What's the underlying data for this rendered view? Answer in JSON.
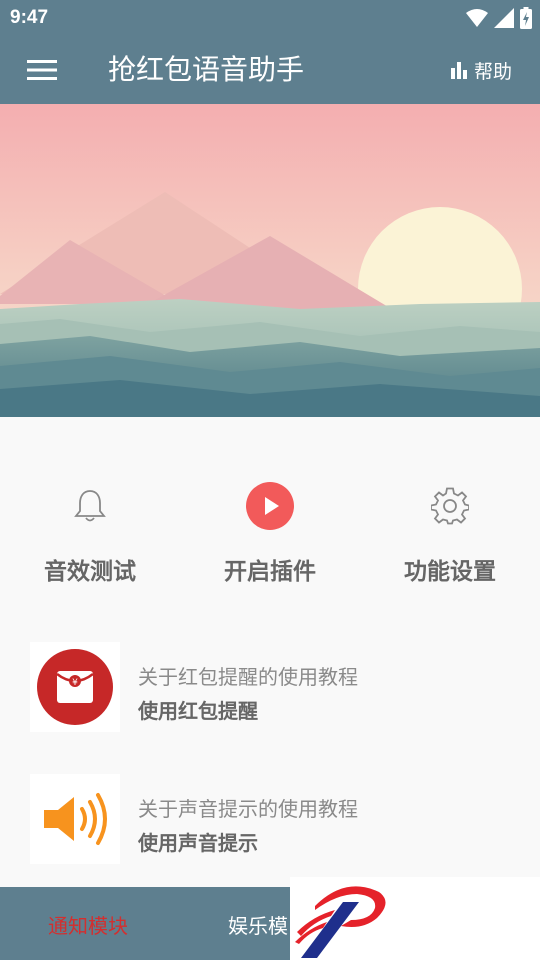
{
  "status_bar": {
    "time": "9:47",
    "icons": [
      "wifi-icon",
      "signal-icon",
      "battery-icon"
    ]
  },
  "app_bar": {
    "title": "抢红包语音助手",
    "help_label": "帮助",
    "menu_icon": "hamburger-menu-icon",
    "help_icon": "bar-chart-icon"
  },
  "actions": [
    {
      "label": "音效测试",
      "icon": "bell-icon"
    },
    {
      "label": "开启插件",
      "icon": "play-circle-icon"
    },
    {
      "label": "功能设置",
      "icon": "gear-icon"
    }
  ],
  "tutorials": [
    {
      "subtitle": "关于红包提醒的使用教程",
      "title": "使用红包提醒",
      "icon": "red-envelope-icon"
    },
    {
      "subtitle": "关于声音提示的使用教程",
      "title": "使用声音提示",
      "icon": "speaker-icon"
    }
  ],
  "bottom_nav": {
    "tabs": [
      {
        "label": "通知模块",
        "active": true
      },
      {
        "label": "娱乐模",
        "active": false
      }
    ]
  },
  "colors": {
    "primary": "#5e7f8f",
    "accent_red": "#d32f2f",
    "play_red": "#f25a5a",
    "speaker_orange": "#f7931e",
    "background": "#f9f9f9"
  }
}
